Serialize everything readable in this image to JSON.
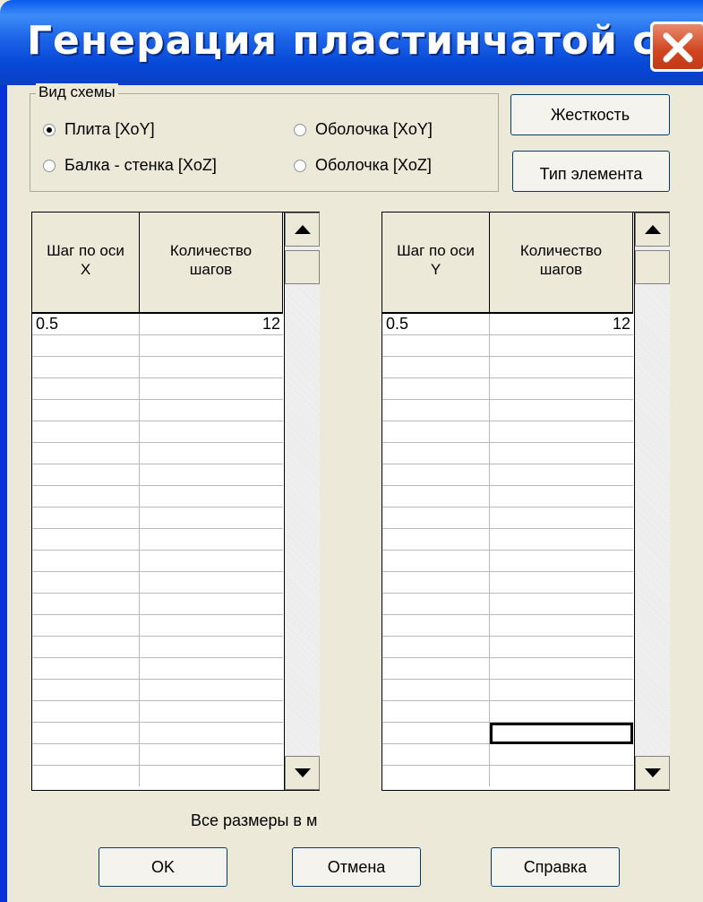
{
  "window": {
    "title": "Генерация пластинчатой сх..."
  },
  "scheme": {
    "group_label": "Вид схемы",
    "options": [
      {
        "label": "Плита [XoY]",
        "checked": true
      },
      {
        "label": "Оболочка [XoY]",
        "checked": false
      },
      {
        "label": "Балка - стенка [XoZ]",
        "checked": false
      },
      {
        "label": "Оболочка [XoZ]",
        "checked": false
      }
    ]
  },
  "side_buttons": {
    "stiffness": "Жесткость",
    "element_type": "Тип элемента"
  },
  "grid_x": {
    "header_step": "Шаг по оси\nX",
    "header_count": "Количество\nшагов",
    "rows": [
      {
        "step": "0.5",
        "count": "12"
      }
    ]
  },
  "grid_y": {
    "header_step": "Шаг по оси\nY",
    "header_count": "Количество\nшагов",
    "rows": [
      {
        "step": "0.5",
        "count": "12"
      }
    ]
  },
  "units_label": "Все размеры в",
  "units_value": "м",
  "buttons": {
    "ok": "OK",
    "cancel": "Отмена",
    "help": "Справка"
  },
  "icons": {
    "close": "close-icon",
    "scroll_up": "arrow-up-icon",
    "scroll_down": "arrow-down-icon"
  }
}
